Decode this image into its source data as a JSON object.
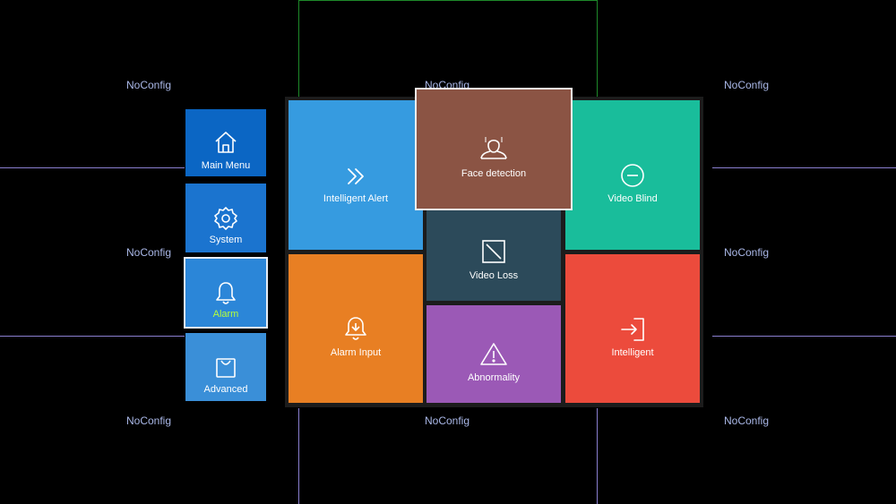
{
  "background": {
    "no_config_label": "NoConfig",
    "cells": [
      "NoConfig",
      "NoConfig",
      "NoConfig",
      "NoConfig",
      "NoConfig",
      "NoConfig",
      "NoConfig",
      "NoConfig",
      "NoConfig"
    ]
  },
  "sidebar": {
    "items": [
      {
        "label": "Main Menu",
        "icon": "home-icon",
        "selected": false,
        "color": "#0b66c4"
      },
      {
        "label": "System",
        "icon": "gear-icon",
        "selected": false,
        "color": "#1b74cf"
      },
      {
        "label": "Alarm",
        "icon": "bell-icon",
        "selected": true,
        "color": "#2b86d8",
        "label_color": "#b6ff3a"
      },
      {
        "label": "Advanced",
        "icon": "bag-icon",
        "selected": false,
        "color": "#3a8fd8"
      }
    ]
  },
  "tiles": {
    "intelligent_alert": {
      "label": "Intelligent Alert",
      "icon": "double-chevron-right-icon",
      "color": "#369be0"
    },
    "face_detection": {
      "label": "Face detection",
      "icon": "face-icon",
      "color": "#8b5444",
      "focused": true
    },
    "video_blind": {
      "label": "Video Blind",
      "icon": "minus-circle-icon",
      "color": "#19bd9b"
    },
    "video_loss": {
      "label": "Video Loss",
      "icon": "video-loss-icon",
      "color": "#2c4a5a"
    },
    "alarm_input": {
      "label": "Alarm Input",
      "icon": "alarm-input-icon",
      "color": "#e87f23"
    },
    "abnormality": {
      "label": "Abnormality",
      "icon": "warning-triangle-icon",
      "color": "#9b59b6"
    },
    "intelligent": {
      "label": "Intelligent",
      "icon": "enter-box-icon",
      "color": "#ec4b3c"
    }
  }
}
